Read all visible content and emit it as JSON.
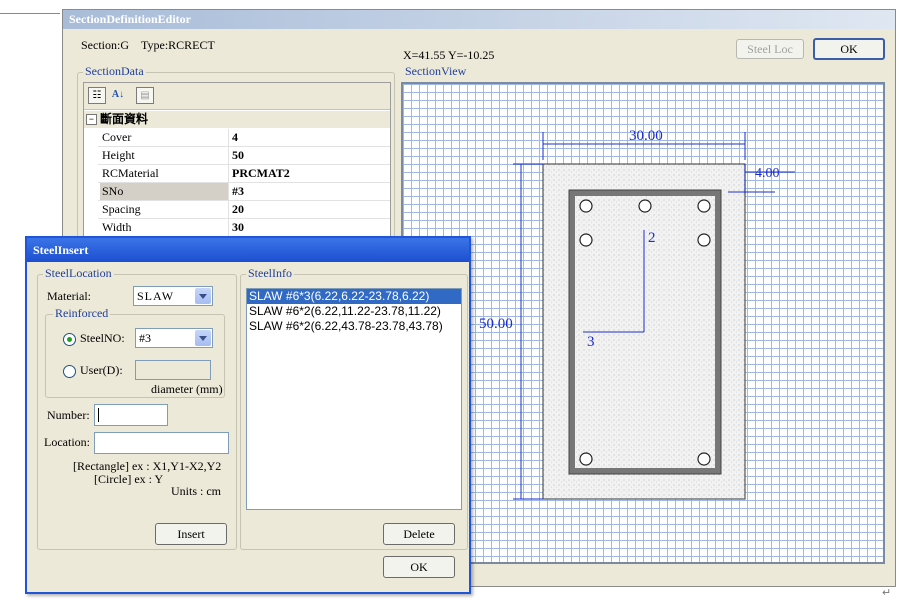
{
  "editor": {
    "title": "SectionDefinitionEditor",
    "section_label": "Section:G",
    "type_label": "Type:RCRECT",
    "coords": "X=41.55  Y=-10.25",
    "steel_loc_button": "Steel Loc",
    "ok_button": "OK",
    "section_data_group": "SectionData",
    "section_view_group": "SectionView",
    "grid": {
      "category": "斷面資料",
      "rows": [
        {
          "key": "Cover",
          "value": "4"
        },
        {
          "key": "Height",
          "value": "50"
        },
        {
          "key": "RCMaterial",
          "value": "PRCMAT2"
        },
        {
          "key": "SNo",
          "value": "#3"
        },
        {
          "key": "Spacing",
          "value": "20"
        },
        {
          "key": "Width",
          "value": "30"
        }
      ]
    },
    "view": {
      "width_dim": "30.00",
      "cover_dim": "4.00",
      "height_dim": "50.00",
      "axis_2": "2",
      "axis_3": "3"
    }
  },
  "steel_insert": {
    "title": "SteelInsert",
    "location_group": "SteelLocation",
    "info_group": "SteelInfo",
    "material_label": "Material:",
    "material_value": "SLAW",
    "reinforced_group": "Reinforced",
    "steelno_label": "SteelNO:",
    "steelno_value": "#3",
    "user_label": "User(D):",
    "diameter_label": "diameter (mm)",
    "number_label": "Number:",
    "location_label": "Location:",
    "hint_rect": "[Rectangle] ex : X1,Y1-X2,Y2",
    "hint_circle": "[Circle] ex : Y",
    "units": "Units : cm",
    "insert_button": "Insert",
    "delete_button": "Delete",
    "ok_button": "OK",
    "steel_list": [
      "SLAW  #6*3(6.22,6.22-23.78,6.22)",
      "SLAW  #6*2(6.22,11.22-23.78,11.22)",
      "SLAW  #6*2(6.22,43.78-23.78,43.78)"
    ]
  }
}
